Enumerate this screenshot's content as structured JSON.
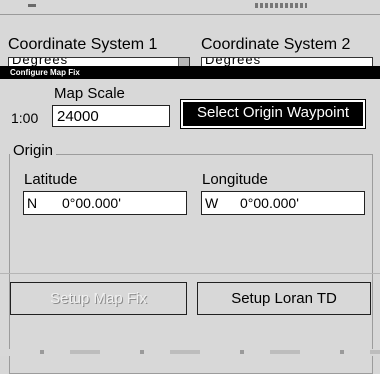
{
  "background_window": {
    "label_1": "Coordinate System 1",
    "label_2": "Coordinate System 2",
    "combo_1_value": "Degrees",
    "combo_2_value": "Degrees"
  },
  "dialog": {
    "title": "Configure Map Fix",
    "map_scale": {
      "label": "Map Scale",
      "prefix": "1:00",
      "value": "24000"
    },
    "select_origin_button": "Select Origin Waypoint",
    "origin": {
      "group_label": "Origin",
      "latitude": {
        "label": "Latitude",
        "hemisphere": "N",
        "value": "0°00.000'"
      },
      "longitude": {
        "label": "Longitude",
        "hemisphere": "W",
        "value": "0°00.000'"
      }
    },
    "buttons": {
      "setup_map_fix": "Setup Map Fix",
      "setup_loran_td": "Setup Loran TD"
    }
  },
  "colors": {
    "background": "#d8d8d8",
    "titlebar": "#000000",
    "field": "#ffffff"
  }
}
